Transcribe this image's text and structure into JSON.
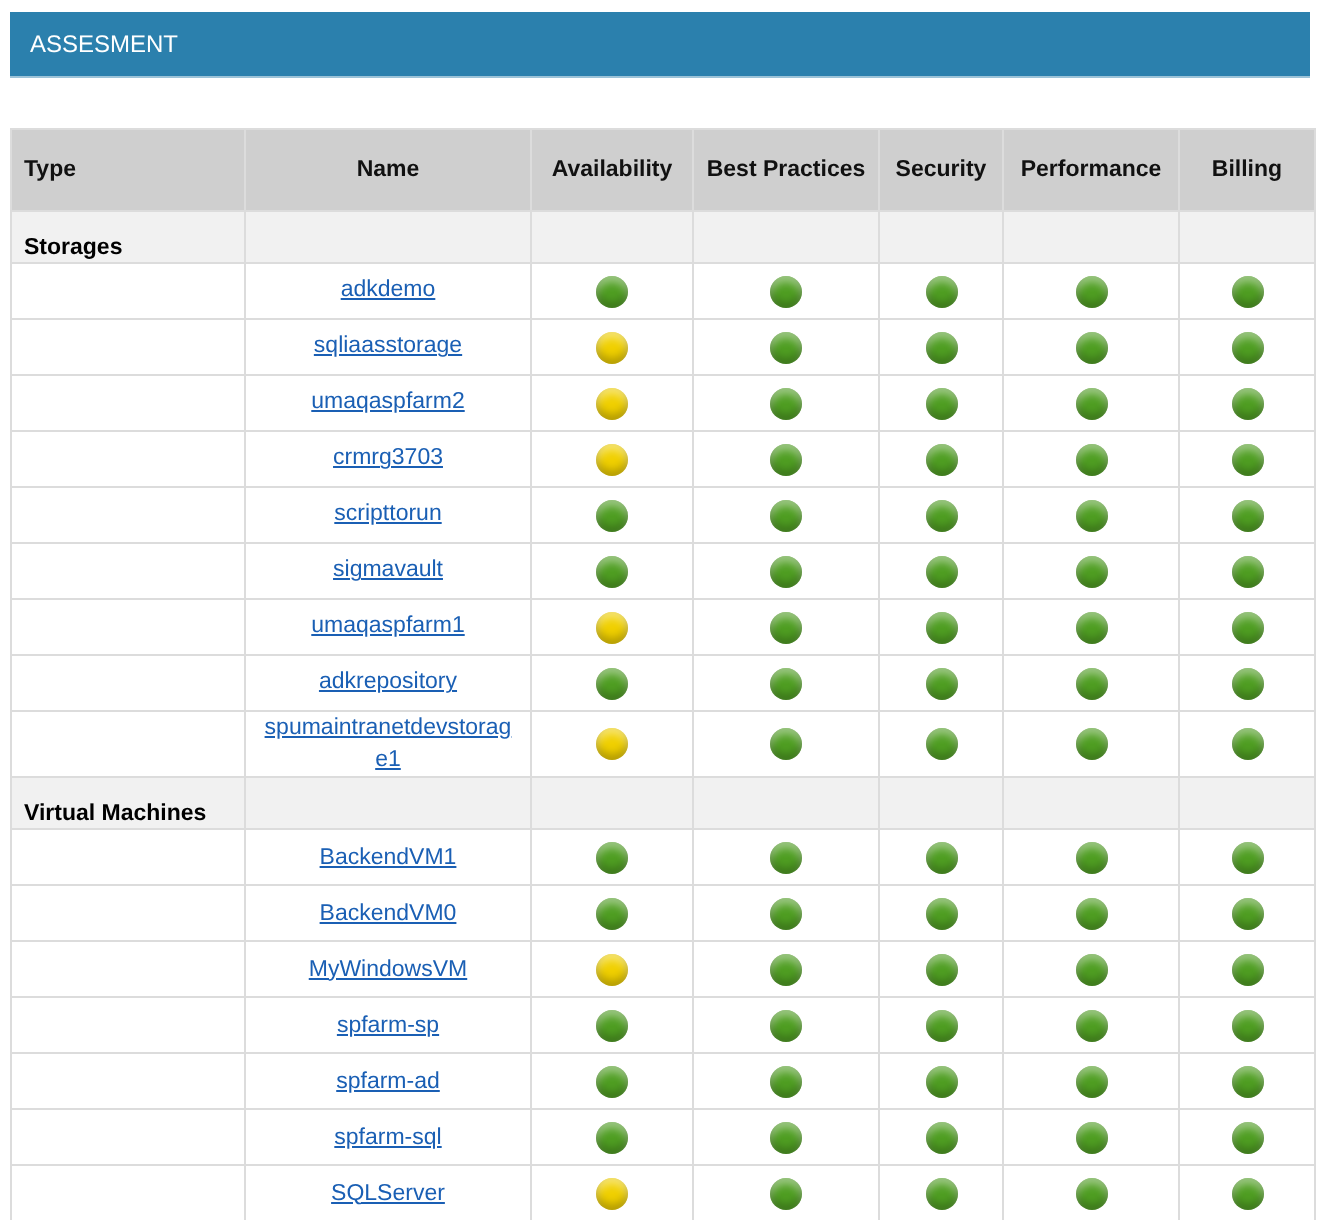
{
  "header": {
    "title": "ASSESMENT"
  },
  "table": {
    "columns": [
      "Type",
      "Name",
      "Availability",
      "Best Practices",
      "Security",
      "Performance",
      "Billing"
    ],
    "groups": [
      {
        "type": "Storages",
        "rows": [
          {
            "name": "adkdemo",
            "statuses": [
              {
                "color": "#4f9e22"
              },
              {
                "color": "#4f9e22"
              },
              {
                "color": "#4f9e22"
              },
              {
                "color": "#4f9e22"
              },
              {
                "color": "#4f9e22"
              }
            ]
          },
          {
            "name": "sqliaasstorage",
            "statuses": [
              {
                "color": "#f0d000"
              },
              {
                "color": "#4f9e22"
              },
              {
                "color": "#4f9e22"
              },
              {
                "color": "#4f9e22"
              },
              {
                "color": "#4f9e22"
              }
            ]
          },
          {
            "name": "umaqaspfarm2",
            "statuses": [
              {
                "color": "#f0d000"
              },
              {
                "color": "#4f9e22"
              },
              {
                "color": "#4f9e22"
              },
              {
                "color": "#4f9e22"
              },
              {
                "color": "#4f9e22"
              }
            ]
          },
          {
            "name": "crmrg3703",
            "statuses": [
              {
                "color": "#f0d000"
              },
              {
                "color": "#4f9e22"
              },
              {
                "color": "#4f9e22"
              },
              {
                "color": "#4f9e22"
              },
              {
                "color": "#4f9e22"
              }
            ]
          },
          {
            "name": "scripttorun",
            "statuses": [
              {
                "color": "#4f9e22"
              },
              {
                "color": "#4f9e22"
              },
              {
                "color": "#4f9e22"
              },
              {
                "color": "#4f9e22"
              },
              {
                "color": "#4f9e22"
              }
            ]
          },
          {
            "name": "sigmavault",
            "statuses": [
              {
                "color": "#4f9e22"
              },
              {
                "color": "#4f9e22"
              },
              {
                "color": "#4f9e22"
              },
              {
                "color": "#4f9e22"
              },
              {
                "color": "#4f9e22"
              }
            ]
          },
          {
            "name": "umaqaspfarm1",
            "statuses": [
              {
                "color": "#f0d000"
              },
              {
                "color": "#4f9e22"
              },
              {
                "color": "#4f9e22"
              },
              {
                "color": "#4f9e22"
              },
              {
                "color": "#4f9e22"
              }
            ]
          },
          {
            "name": "adkrepository",
            "statuses": [
              {
                "color": "#4f9e22"
              },
              {
                "color": "#4f9e22"
              },
              {
                "color": "#4f9e22"
              },
              {
                "color": "#4f9e22"
              },
              {
                "color": "#4f9e22"
              }
            ]
          },
          {
            "name": "spumaintranetdevstorage1",
            "statuses": [
              {
                "color": "#f0d000"
              },
              {
                "color": "#4f9e22"
              },
              {
                "color": "#4f9e22"
              },
              {
                "color": "#4f9e22"
              },
              {
                "color": "#4f9e22"
              }
            ]
          }
        ]
      },
      {
        "type": "Virtual Machines",
        "rows": [
          {
            "name": "BackendVM1",
            "statuses": [
              {
                "color": "#4f9e22"
              },
              {
                "color": "#4f9e22"
              },
              {
                "color": "#4f9e22"
              },
              {
                "color": "#4f9e22"
              },
              {
                "color": "#4f9e22"
              }
            ]
          },
          {
            "name": "BackendVM0",
            "statuses": [
              {
                "color": "#4f9e22"
              },
              {
                "color": "#4f9e22"
              },
              {
                "color": "#4f9e22"
              },
              {
                "color": "#4f9e22"
              },
              {
                "color": "#4f9e22"
              }
            ]
          },
          {
            "name": "MyWindowsVM",
            "statuses": [
              {
                "color": "#f0d000"
              },
              {
                "color": "#4f9e22"
              },
              {
                "color": "#4f9e22"
              },
              {
                "color": "#4f9e22"
              },
              {
                "color": "#4f9e22"
              }
            ]
          },
          {
            "name": "spfarm-sp",
            "statuses": [
              {
                "color": "#4f9e22"
              },
              {
                "color": "#4f9e22"
              },
              {
                "color": "#4f9e22"
              },
              {
                "color": "#4f9e22"
              },
              {
                "color": "#4f9e22"
              }
            ]
          },
          {
            "name": "spfarm-ad",
            "statuses": [
              {
                "color": "#4f9e22"
              },
              {
                "color": "#4f9e22"
              },
              {
                "color": "#4f9e22"
              },
              {
                "color": "#4f9e22"
              },
              {
                "color": "#4f9e22"
              }
            ]
          },
          {
            "name": "spfarm-sql",
            "statuses": [
              {
                "color": "#4f9e22"
              },
              {
                "color": "#4f9e22"
              },
              {
                "color": "#4f9e22"
              },
              {
                "color": "#4f9e22"
              },
              {
                "color": "#4f9e22"
              }
            ]
          },
          {
            "name": "SQLServer",
            "statuses": [
              {
                "color": "#f0d000"
              },
              {
                "color": "#4f9e22"
              },
              {
                "color": "#4f9e22"
              },
              {
                "color": "#4f9e22"
              },
              {
                "color": "#4f9e22"
              }
            ]
          }
        ]
      }
    ]
  }
}
